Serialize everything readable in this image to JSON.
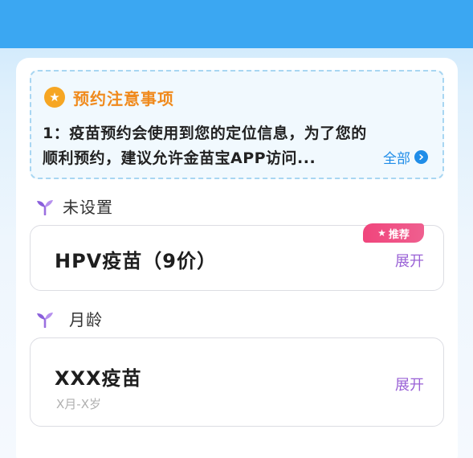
{
  "notice": {
    "icon": "star-icon",
    "title": "预约注意事项",
    "line1": "1：疫苗预约会使用到您的定位信息，为了您的",
    "line2": "顺利预约，建议允许金苗宝APP访问...",
    "more_label": "全部",
    "more_icon": "chevron-right-circle-icon"
  },
  "groups": [
    {
      "label": "未设置",
      "icon": "sprout-icon",
      "card": {
        "title": "HPV疫苗（9价）",
        "badge": "推荐",
        "badge_icon": "star-icon",
        "expand_label": "展开"
      }
    },
    {
      "label": "月龄",
      "icon": "sprout-icon",
      "card": {
        "title": "XXX疫苗",
        "subtitle": "X月-X岁",
        "expand_label": "展开"
      }
    }
  ],
  "colors": {
    "header_bar": "#3ba7f2",
    "notice_title": "#f08a1c",
    "link_blue": "#1f8de8",
    "accent_purple": "#9a62d6",
    "badge_pink": "#f0457c"
  }
}
